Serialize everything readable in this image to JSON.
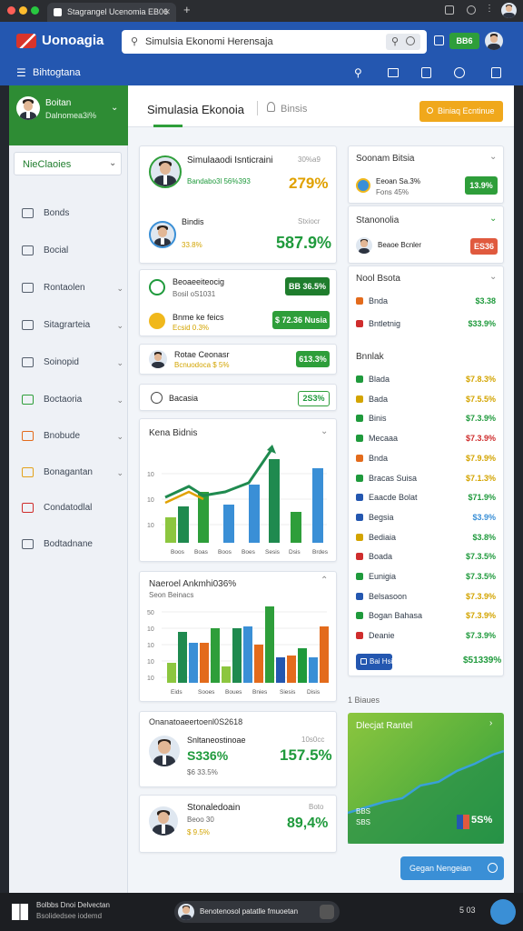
{
  "browser": {
    "tab_title": "Stagrangel Ucenomia EB06",
    "close": "✕",
    "new_tab": "+"
  },
  "app": {
    "logo": "Uonoagia",
    "search_value": "Simulsia Ekonomi Herensaja",
    "badge_label": "BB6"
  },
  "nav": {
    "title": "Bihtogtana"
  },
  "sidebar": {
    "user_name": "Boitan",
    "user_sub": "Dalnomea3i%",
    "filter_label": "NieClaoies",
    "items": [
      {
        "label": "Bonds",
        "color": "#56606e"
      },
      {
        "label": "Bocial",
        "color": "#56606e"
      },
      {
        "label": "Rontaolen",
        "color": "#56606e"
      },
      {
        "label": "Sitagrarteia",
        "color": "#56606e"
      },
      {
        "label": "Soinopid",
        "color": "#56606e"
      },
      {
        "label": "Boctaoria",
        "color": "#2e9e3a"
      },
      {
        "label": "Bnobude",
        "color": "#e36b1c"
      },
      {
        "label": "Bonagantan",
        "color": "#e3a21c"
      },
      {
        "label": "Condatodlal",
        "color": "#cf2d2d"
      },
      {
        "label": "Bodtadnane",
        "color": "#56606e"
      }
    ]
  },
  "header": {
    "title": "Simulasia Ekonoia",
    "crumb": "Binsis",
    "action": "Biniaq Ecntinue"
  },
  "profiles": {
    "p1": {
      "name": "Simulaaodi Isnticraini",
      "sub": "Bandabo3l 56%393",
      "tag": "30%a9",
      "value": "279%"
    },
    "p2": {
      "name": "Bindis",
      "sub": "33.8%",
      "tag": "Stxiocr",
      "value": "587.9%"
    }
  },
  "mini": {
    "m1": {
      "name": "Beoaeeiteocig",
      "sub": "Bosil oS1031",
      "value": "BB 36.5%"
    },
    "m2": {
      "name": "Bnme ke feics",
      "sub": "Ecsid 0.3%",
      "value": "$ 72.36 Nusia"
    }
  },
  "single": {
    "name": "Rotae Ceonasr",
    "sub": "Bcnuodoca $ 5%",
    "value": "613.3%"
  },
  "smallrow": {
    "name": "Bacasia",
    "value": "2S3%"
  },
  "chart1": {
    "title": "Kena Bidnis",
    "y_ticks": [
      "10",
      "10",
      "10"
    ],
    "categories": [
      "Boos",
      "Boas",
      "Boos",
      "Boes",
      "Sesis",
      "Dsis",
      "Brdes"
    ]
  },
  "chart2": {
    "title": "Naeroel Ankmhi036%",
    "sub": "Seon Beinacs",
    "y_ticks": [
      "50",
      "10",
      "10",
      "10",
      "10"
    ],
    "categories": [
      "Eids",
      "Sooes",
      "Boues",
      "Bnies",
      "Siesis",
      "Disis"
    ]
  },
  "bottom1": {
    "header": "Onanatoaeertoenl0S2618",
    "name": "Snltaneostinoae",
    "tag": "10s0cc",
    "left_value": "S336%",
    "sub": "$6 33.5%",
    "value": "157.5%"
  },
  "bottom2": {
    "name": "Stonaledoain",
    "tag": "Boto",
    "sub": "Beoo 30",
    "sub2": "$ 9.5%",
    "value": "89,4%"
  },
  "right": {
    "p1": {
      "title": "Soonam Bitsia",
      "name": "Eeoan Sa.3%",
      "sub": "Fons 45%",
      "value": "13.9%"
    },
    "p2": {
      "title": "Stanonolia",
      "name": "Beaoe Bcnler",
      "sub": "Soiocc 3.3%",
      "value": "ES36"
    },
    "p3": {
      "title": "Nool Bsota"
    },
    "list_a": [
      {
        "label": "Bnda",
        "value": "$3.38",
        "icolor": "#e36b1c",
        "vcolor": "#1f9a3c"
      },
      {
        "label": "Bntletnig",
        "value": "$33.9%",
        "icolor": "#cf2d2d",
        "vcolor": "#1f9a3c"
      }
    ],
    "section": "Bnnlak",
    "list_b": [
      {
        "label": "Blada",
        "value": "$7.8.3%",
        "icolor": "#1f9a3c",
        "vcolor": "#d3a400"
      },
      {
        "label": "Bada",
        "value": "$7.5.5%",
        "icolor": "#d3a400",
        "vcolor": "#d3a400"
      },
      {
        "label": "Binis",
        "value": "$7.3.9%",
        "icolor": "#1f9a3c",
        "vcolor": "#1f9a3c"
      },
      {
        "label": "Mecaaa",
        "value": "$7.3.9%",
        "icolor": "#1f9a3c",
        "vcolor": "#cf2d2d"
      },
      {
        "label": "Bnda",
        "value": "$7.9.9%",
        "icolor": "#e36b1c",
        "vcolor": "#d3a400"
      },
      {
        "label": "Bracas Suisa",
        "value": "$7.1.3%",
        "icolor": "#1f9a3c",
        "vcolor": "#d3a400"
      },
      {
        "label": "Eaacde Bolat",
        "value": "$71.9%",
        "icolor": "#2457b0",
        "vcolor": "#1f9a3c"
      },
      {
        "label": "Begsia",
        "value": "$3.9%",
        "icolor": "#2457b0",
        "vcolor": "#3a8fd6"
      },
      {
        "label": "Bediaia",
        "value": "$3.8%",
        "icolor": "#d3a400",
        "vcolor": "#1f9a3c"
      },
      {
        "label": "Boada",
        "value": "$7.3.5%",
        "icolor": "#cf2d2d",
        "vcolor": "#1f9a3c"
      },
      {
        "label": "Eunigia",
        "value": "$7.3.5%",
        "icolor": "#1f9a3c",
        "vcolor": "#1f9a3c"
      },
      {
        "label": "Belsasoon",
        "value": "$7.3.9%",
        "icolor": "#2457b0",
        "vcolor": "#d3a400"
      },
      {
        "label": "Bogan Bahasa",
        "value": "$7.3.9%",
        "icolor": "#1f9a3c",
        "vcolor": "#d3a400"
      },
      {
        "label": "Deanie",
        "value": "$7.3.9%",
        "icolor": "#cf2d2d",
        "vcolor": "#1f9a3c"
      }
    ],
    "button": "Bai Hsia",
    "total": "$51339%",
    "footer": "1 Biaues"
  },
  "promo": {
    "title": "Dlecjat Rantel",
    "value1": "BBS",
    "value2": "SBS",
    "percent": "5S%",
    "button": "Gegan Nengeian"
  },
  "taskbar": {
    "line1": "Bolbbs Dnoi Delvectan",
    "line2": "Bsolidedsee iodemd",
    "center": "Benotenosol patatlle fmuoetan",
    "time": "5 03"
  }
}
